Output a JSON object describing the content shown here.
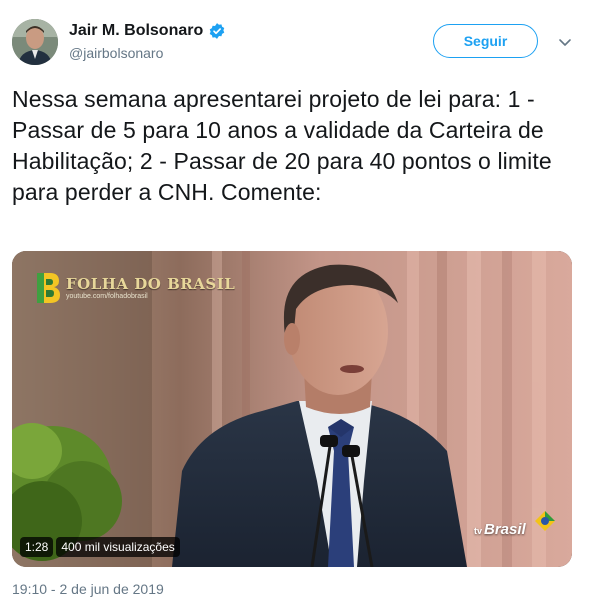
{
  "author": {
    "display_name": "Jair M. Bolsonaro",
    "handle": "@jairbolsonaro",
    "verified": true,
    "avatar_icon": "profile-photo"
  },
  "follow_button": {
    "label": "Seguir"
  },
  "menu": {
    "icon": "chevron-down-icon"
  },
  "tweet": {
    "text": "Nessa semana apresentarei projeto de lei para: 1 - Passar de 5 para 10 anos a validade da Carteira de Habilitação; 2 - Passar de 20 para 40 pontos o limite para perder a CNH. Comente:"
  },
  "video": {
    "duration": "1:28",
    "views": "400 mil visualizações",
    "watermark_brand": "FOLHA DO BRASIL",
    "watermark_url": "youtube.com/folhadobrasil",
    "channel_bug_prefix": "tv",
    "channel_bug_name": "Brasil"
  },
  "timestamp": "19:10 - 2 de jun de 2019",
  "colors": {
    "accent": "#1da1f2",
    "text": "#14171a",
    "secondary": "#657786"
  }
}
